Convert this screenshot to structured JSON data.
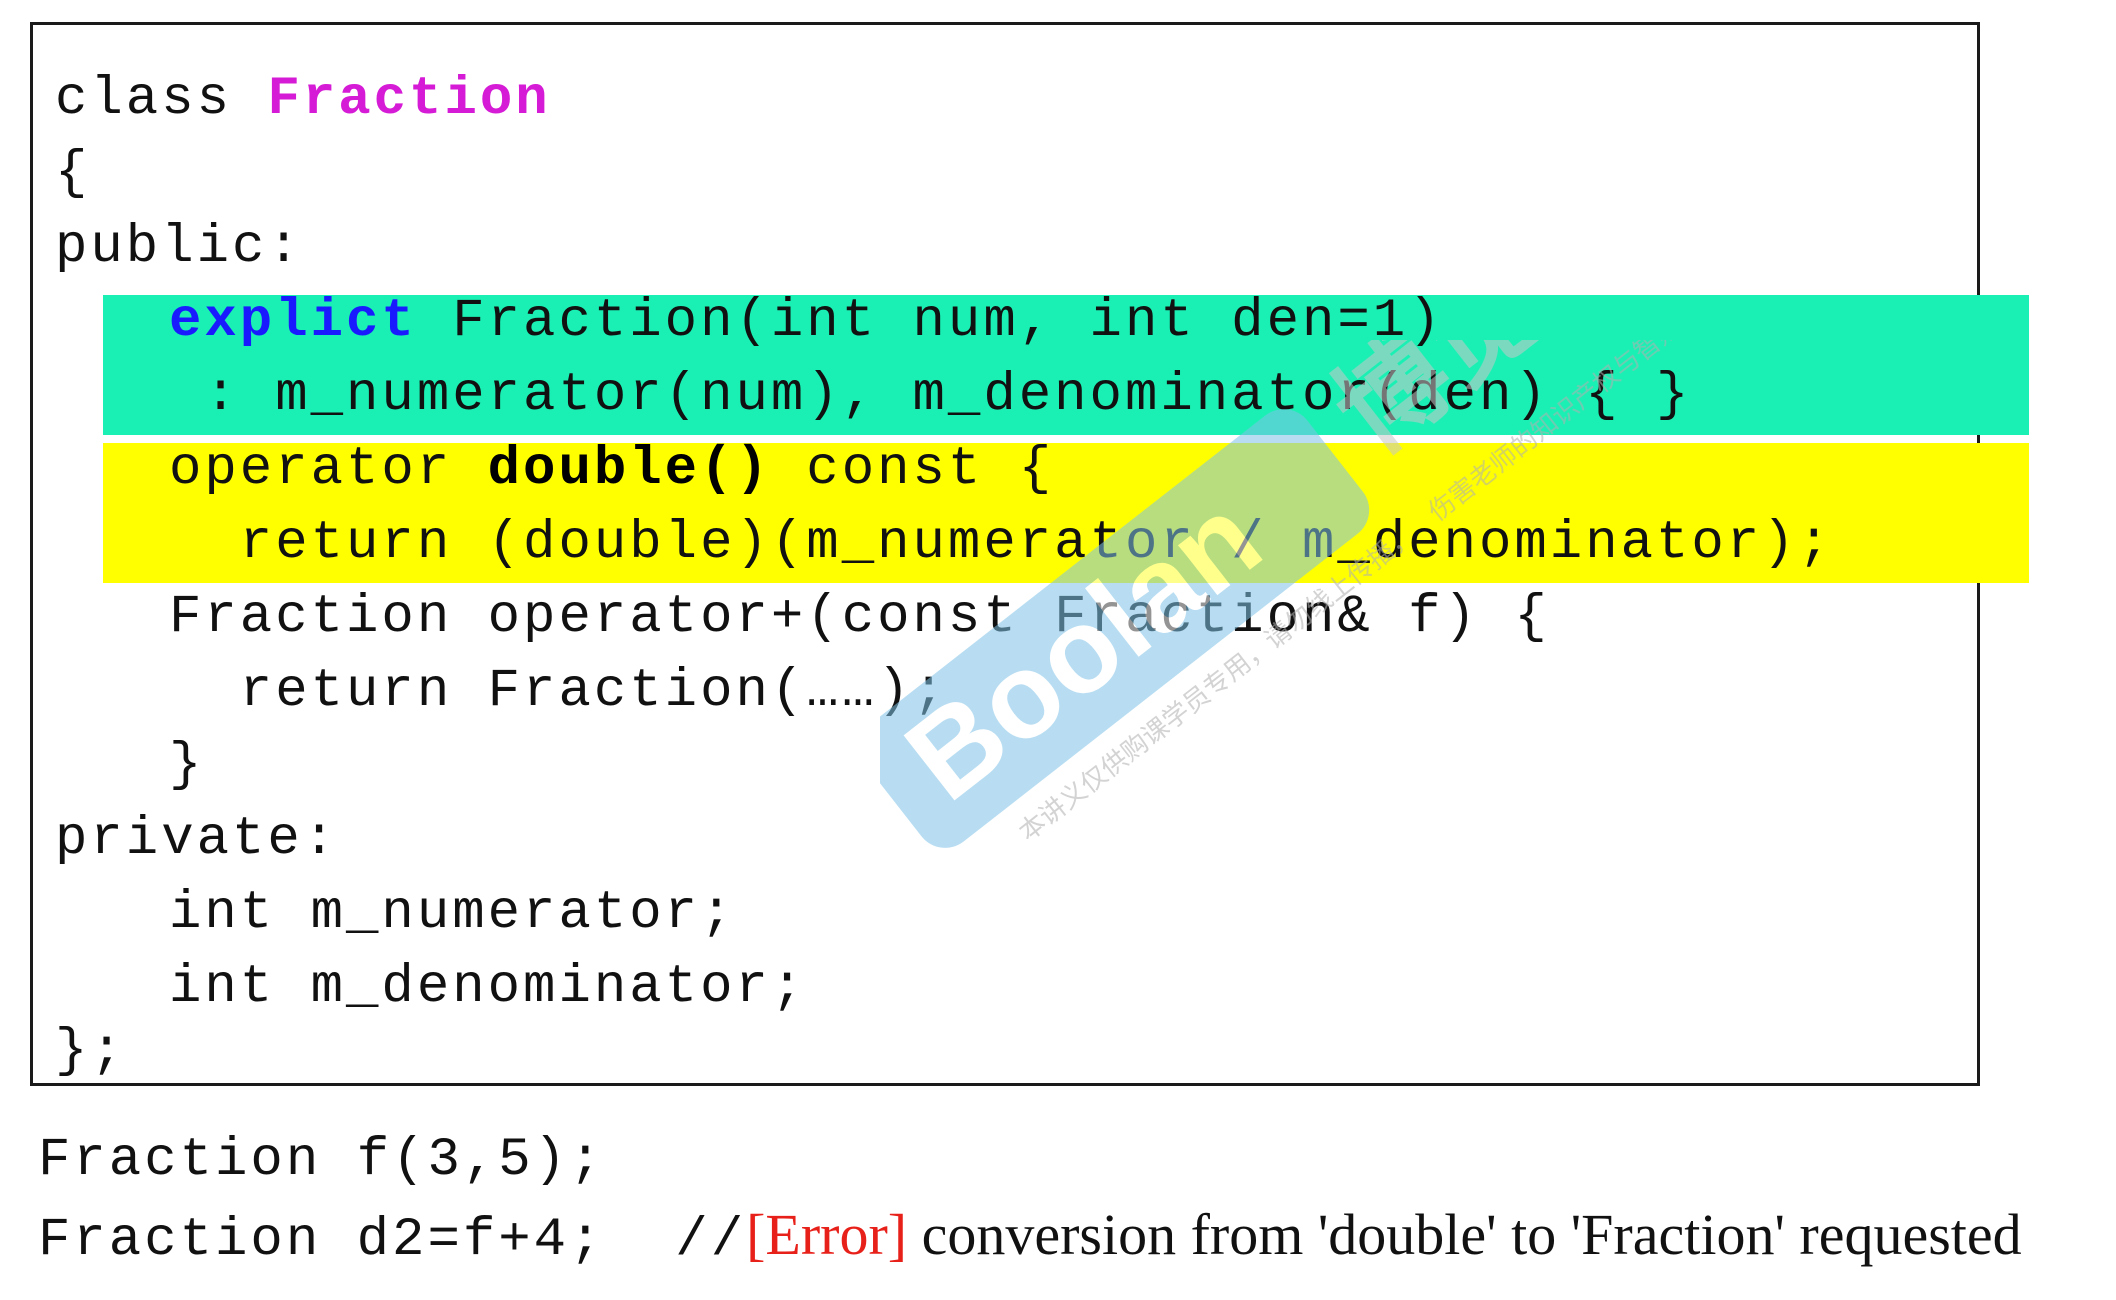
{
  "code": {
    "line1_pre": "class ",
    "line1_name": "Fraction",
    "line2": "{",
    "line3": "public:",
    "line4_kw": "explict",
    "line4_rest": " Fraction(int num, int den=1)",
    "line5": " : m_numerator(num), m_denominator(den) { }",
    "line6_pre": "operator ",
    "line6_bold": "double()",
    "line6_rest": " const {",
    "line7": "  return (double)(m_numerator / m_denominator);",
    "line8": "Fraction operator+(const Fraction& f) {",
    "line9": "  return Fraction(……);",
    "line10": "}",
    "line11": "private:",
    "line12": "int m_numerator;",
    "line13": "int m_denominator;",
    "line14": "};"
  },
  "usage": {
    "line1": "Fraction f(3,5);",
    "line2_code": "Fraction d2=f+4;  //",
    "line2_error": "[Error]",
    "line2_msg": " conversion from 'double' to 'Fraction' requested"
  },
  "watermark": {
    "brand": "Boolan",
    "cn_name": "博览网",
    "notice_a": "本讲义仅供购课学员专用，请勿线上传播，",
    "notice_b": "伤害老师的知识产权与智财权。",
    "color": "#7fc3e8"
  },
  "colors": {
    "class_name": "#d51bd5",
    "explicit_kw": "#1a1aff",
    "cyan_highlight": "#1bf0b4",
    "yellow_highlight": "#ffff00",
    "error": "#e8201a"
  }
}
